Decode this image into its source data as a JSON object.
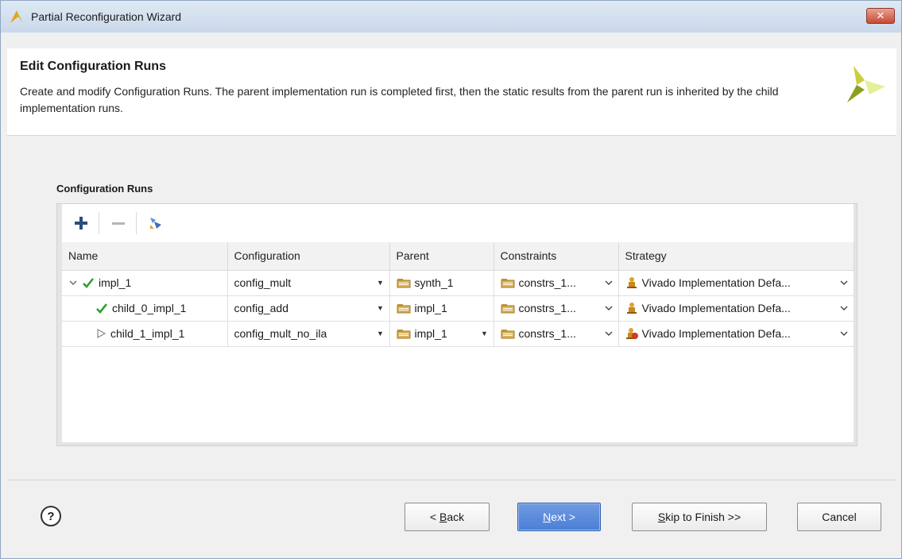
{
  "window": {
    "title": "Partial Reconfiguration Wizard",
    "close_label": "✕"
  },
  "header": {
    "title": "Edit Configuration Runs",
    "description": "Create and modify Configuration Runs. The parent implementation run is completed first, then the static results from the parent run is inherited by the child implementation runs."
  },
  "section": {
    "label": "Configuration Runs"
  },
  "table": {
    "columns": [
      "Name",
      "Configuration",
      "Parent",
      "Constraints",
      "Strategy"
    ],
    "rows": [
      {
        "name": "impl_1",
        "configuration": "config_mult",
        "parent": "synth_1",
        "constraints": "constrs_1...",
        "strategy": "Vivado Implementation Defa..."
      },
      {
        "name": "child_0_impl_1",
        "configuration": "config_add",
        "parent": "impl_1",
        "constraints": "constrs_1...",
        "strategy": "Vivado Implementation Defa..."
      },
      {
        "name": "child_1_impl_1",
        "configuration": "config_mult_no_ila",
        "parent": "impl_1",
        "constraints": "constrs_1...",
        "strategy": "Vivado Implementation Defa..."
      }
    ]
  },
  "footer": {
    "help": "?",
    "back": {
      "prefix": "< ",
      "mnemonic": "B",
      "rest": "ack"
    },
    "next": {
      "mnemonic": "N",
      "rest": "ext >"
    },
    "skip": {
      "mnemonic": "S",
      "rest": "kip to Finish >>"
    },
    "cancel": "Cancel"
  },
  "colors": {
    "accent": "#4b7fd6",
    "check": "#2ea02e",
    "folder": "#d8b35a"
  }
}
